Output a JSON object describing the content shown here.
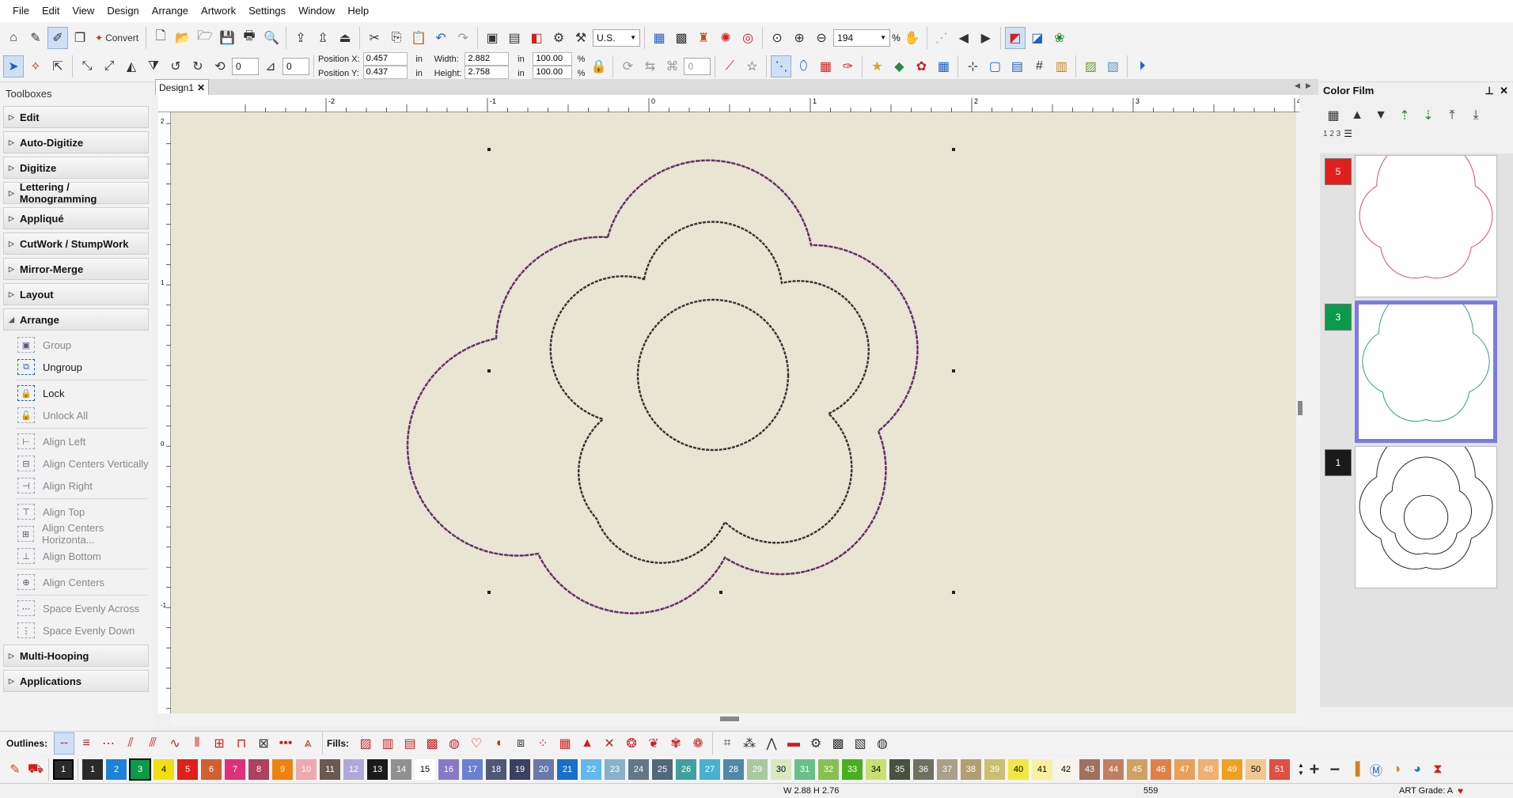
{
  "menu": [
    "File",
    "Edit",
    "View",
    "Design",
    "Arrange",
    "Artwork",
    "Settings",
    "Window",
    "Help"
  ],
  "toolbar": {
    "convert_label": "Convert",
    "units": "U.S.",
    "zoom": "194",
    "zoom_unit": "%",
    "rotate_angle": "0",
    "slant_angle": "0",
    "disabled_value": "0"
  },
  "position": {
    "x_label": "Position X:",
    "x": "0.457",
    "y_label": "Position Y:",
    "y": "0.437",
    "width_label": "Width:",
    "width": "2.882",
    "height_label": "Height:",
    "height": "2.758",
    "unit": "in",
    "scale_w": "100.00",
    "scale_h": "100.00",
    "pct": "%"
  },
  "toolboxes": {
    "title": "Toolboxes",
    "sections_top": [
      "Edit",
      "Auto-Digitize",
      "Digitize",
      "Lettering / Monogramming",
      "Appliqué",
      "CutWork / StumpWork",
      "Mirror-Merge",
      "Layout"
    ],
    "expanded": "Arrange",
    "arrange_items": [
      {
        "label": "Group",
        "enabled": false
      },
      {
        "label": "Ungroup",
        "enabled": true
      },
      {
        "label": "Lock",
        "enabled": true
      },
      {
        "label": "Unlock All",
        "enabled": false
      },
      {
        "label": "Align Left",
        "enabled": false
      },
      {
        "label": "Align Centers Vertically",
        "enabled": false
      },
      {
        "label": "Align Right",
        "enabled": false
      },
      {
        "label": "Align Top",
        "enabled": false
      },
      {
        "label": "Align Centers Horizonta...",
        "enabled": false
      },
      {
        "label": "Align Bottom",
        "enabled": false
      },
      {
        "label": "Align Centers",
        "enabled": false
      },
      {
        "label": "Space Evenly Across",
        "enabled": false
      },
      {
        "label": "Space Evenly Down",
        "enabled": false
      }
    ],
    "sections_bottom": [
      "Multi-Hooping",
      "Applications"
    ]
  },
  "design_tab": {
    "label": "Design1"
  },
  "ruler": {
    "h_ticks": [
      "-2",
      "-1",
      "0",
      "1",
      "2",
      "3",
      "4"
    ],
    "v_ticks": [
      "2",
      "1",
      "0",
      "-1"
    ]
  },
  "color_film": {
    "title": "Color Film",
    "counter_label": "1 2 3",
    "items": [
      {
        "number": "5",
        "color": "#e0201c",
        "selected": false,
        "stroke": "#d45060"
      },
      {
        "number": "3",
        "color": "#0a9b4a",
        "selected": true,
        "stroke": "#2a9a7a"
      },
      {
        "number": "1",
        "color": "#1a1a1a",
        "selected": false,
        "stroke": "#222222"
      }
    ]
  },
  "stitch_bar": {
    "outlines_label": "Outlines:",
    "fills_label": "Fills:"
  },
  "palette": [
    {
      "n": "1",
      "c": "#2a2a2a",
      "t": "#fff"
    },
    {
      "n": "2",
      "c": "#1e82d8",
      "t": "#fff"
    },
    {
      "n": "3",
      "c": "#0a9b4a",
      "t": "#fff"
    },
    {
      "n": "4",
      "c": "#f0e010",
      "t": "#000"
    },
    {
      "n": "5",
      "c": "#e0201c",
      "t": "#fff"
    },
    {
      "n": "6",
      "c": "#d06030",
      "t": "#fff"
    },
    {
      "n": "7",
      "c": "#e0307a",
      "t": "#fff"
    },
    {
      "n": "8",
      "c": "#b04060",
      "t": "#fff"
    },
    {
      "n": "9",
      "c": "#f08010",
      "t": "#fff"
    },
    {
      "n": "10",
      "c": "#f0a8b0",
      "t": "#fff"
    },
    {
      "n": "11",
      "c": "#6a5a50",
      "t": "#fff"
    },
    {
      "n": "12",
      "c": "#b0a8d8",
      "t": "#fff"
    },
    {
      "n": "13",
      "c": "#1a1a1a",
      "t": "#fff"
    },
    {
      "n": "14",
      "c": "#909090",
      "t": "#fff"
    },
    {
      "n": "15",
      "c": "#ffffff",
      "t": "#000"
    },
    {
      "n": "16",
      "c": "#8878c8",
      "t": "#fff"
    },
    {
      "n": "17",
      "c": "#6a80d0",
      "t": "#fff"
    },
    {
      "n": "18",
      "c": "#505878",
      "t": "#fff"
    },
    {
      "n": "19",
      "c": "#3a4060",
      "t": "#fff"
    },
    {
      "n": "20",
      "c": "#6878a8",
      "t": "#fff"
    },
    {
      "n": "21",
      "c": "#1870c8",
      "t": "#fff"
    },
    {
      "n": "22",
      "c": "#60b8f0",
      "t": "#fff"
    },
    {
      "n": "23",
      "c": "#88b0c8",
      "t": "#fff"
    },
    {
      "n": "24",
      "c": "#607888",
      "t": "#fff"
    },
    {
      "n": "25",
      "c": "#506878",
      "t": "#fff"
    },
    {
      "n": "26",
      "c": "#40a0a0",
      "t": "#fff"
    },
    {
      "n": "27",
      "c": "#48b0d0",
      "t": "#fff"
    },
    {
      "n": "28",
      "c": "#5088a8",
      "t": "#fff"
    },
    {
      "n": "29",
      "c": "#a8c8a0",
      "t": "#fff"
    },
    {
      "n": "30",
      "c": "#d8e8c0",
      "t": "#000"
    },
    {
      "n": "31",
      "c": "#68c088",
      "t": "#fff"
    },
    {
      "n": "32",
      "c": "#88c050",
      "t": "#fff"
    },
    {
      "n": "33",
      "c": "#48b020",
      "t": "#fff"
    },
    {
      "n": "34",
      "c": "#c8e070",
      "t": "#000"
    },
    {
      "n": "35",
      "c": "#485040",
      "t": "#fff"
    },
    {
      "n": "36",
      "c": "#707060",
      "t": "#fff"
    },
    {
      "n": "37",
      "c": "#a8a088",
      "t": "#fff"
    },
    {
      "n": "38",
      "c": "#b0a070",
      "t": "#fff"
    },
    {
      "n": "39",
      "c": "#c8c070",
      "t": "#fff"
    },
    {
      "n": "40",
      "c": "#f0e840",
      "t": "#000"
    },
    {
      "n": "41",
      "c": "#f8f0a0",
      "t": "#000"
    },
    {
      "n": "42",
      "c": "#f8f4e8",
      "t": "#000"
    },
    {
      "n": "43",
      "c": "#a07060",
      "t": "#fff"
    },
    {
      "n": "44",
      "c": "#c08060",
      "t": "#fff"
    },
    {
      "n": "45",
      "c": "#d0a060",
      "t": "#fff"
    },
    {
      "n": "46",
      "c": "#e08048",
      "t": "#fff"
    },
    {
      "n": "47",
      "c": "#e8a058",
      "t": "#fff"
    },
    {
      "n": "48",
      "c": "#f0b070",
      "t": "#fff"
    },
    {
      "n": "49",
      "c": "#f0a020",
      "t": "#fff"
    },
    {
      "n": "50",
      "c": "#f0c890",
      "t": "#000"
    },
    {
      "n": "51",
      "c": "#e05040",
      "t": "#fff"
    }
  ],
  "status": {
    "dims": "W 2.88 H 2.76",
    "stitches": "559",
    "grade": "ART Grade: A"
  },
  "colors": {
    "canvas": "#e8e5d3",
    "outer_outline": "#7a3a7a",
    "inner_outline": "#333333"
  }
}
